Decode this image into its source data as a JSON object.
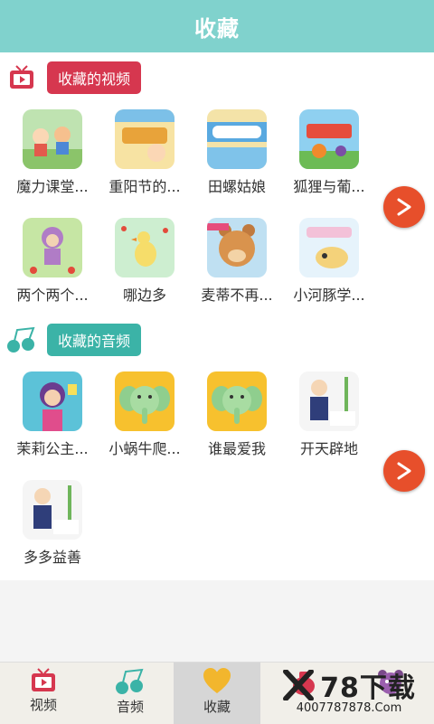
{
  "header": {
    "title": "收藏"
  },
  "video_section": {
    "title": "收藏的视频",
    "items": [
      {
        "label": "魔力课堂..."
      },
      {
        "label": "重阳节的..."
      },
      {
        "label": "田螺姑娘"
      },
      {
        "label": "狐狸与葡..."
      },
      {
        "label": "两个两个..."
      },
      {
        "label": "哪边多"
      },
      {
        "label": "麦蒂不再..."
      },
      {
        "label": "小河豚学..."
      }
    ]
  },
  "audio_section": {
    "title": "收藏的音频",
    "items": [
      {
        "label": "茉莉公主..."
      },
      {
        "label": "小蜗牛爬..."
      },
      {
        "label": "谁最爱我"
      },
      {
        "label": "开天辟地"
      },
      {
        "label": "多多益善"
      }
    ]
  },
  "next_button": {
    "symbol": ">"
  },
  "bottom_nav": {
    "items": [
      {
        "label": "视频"
      },
      {
        "label": "音频"
      },
      {
        "label": "收藏"
      }
    ]
  },
  "watermark": {
    "brand": "78下载",
    "url": "4007787878.Com"
  },
  "colors": {
    "header": "#80d2cd",
    "video_pill": "#d6374f",
    "audio_pill": "#3bb3a7",
    "next_button": "#e74f2b",
    "heart": "#f2b62d"
  }
}
